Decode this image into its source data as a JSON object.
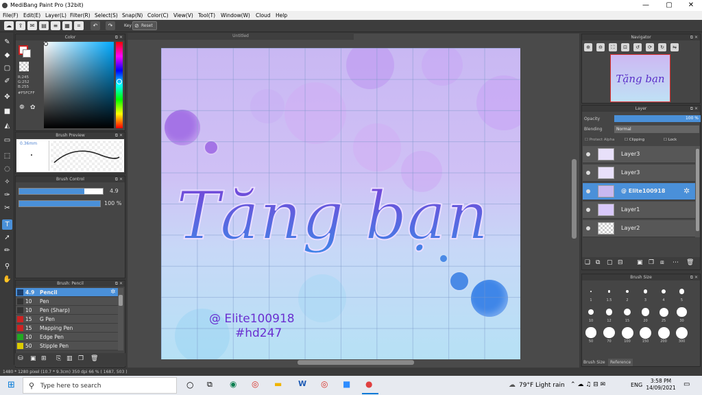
{
  "app": {
    "title": "MediBang Paint Pro (32bit)"
  },
  "window_controls": {
    "minimize": "—",
    "maximize": "▢",
    "close": "✕"
  },
  "menu": [
    "File(F)",
    "Edit(E)",
    "Layer(L)",
    "Filter(R)",
    "Select(S)",
    "Snap(N)",
    "Color(C)",
    "View(V)",
    "Tool(T)",
    "Window(W)",
    "Cloud",
    "Help"
  ],
  "toolbar": {
    "key_label": "Key",
    "reset_label": "Reset"
  },
  "color_panel": {
    "title": "Color",
    "r": "R:245",
    "g": "G:252",
    "b": "B:255",
    "hex": "#F5FCFF",
    "accent": "#cc2222"
  },
  "brush_preview": {
    "title": "Brush Preview",
    "size": "0.36mm"
  },
  "brush_control": {
    "title": "Brush Control",
    "size_value": "4.9",
    "size_fill": 0.78,
    "opacity_value": "100 %",
    "opacity_fill": 1.0
  },
  "brush_list": {
    "title": "Brush: Pencil",
    "items": [
      {
        "size": "4.9",
        "name": "Pencil",
        "color": "#2266aa",
        "selected": true
      },
      {
        "size": "10",
        "name": "Pen",
        "color": "#333333",
        "selected": false
      },
      {
        "size": "10",
        "name": "Pen (Sharp)",
        "color": "#333333",
        "selected": false
      },
      {
        "size": "15",
        "name": "G Pen",
        "color": "#cc2222",
        "selected": false
      },
      {
        "size": "15",
        "name": "Mapping Pen",
        "color": "#cc2222",
        "selected": false
      },
      {
        "size": "10",
        "name": "Edge Pen",
        "color": "#22aa22",
        "selected": false
      },
      {
        "size": "50",
        "name": "Stipple Pen",
        "color": "#ddcc00",
        "selected": false
      }
    ]
  },
  "document": {
    "tab": "Untitled",
    "artwork_title": "Tăng bạn",
    "credit_line1": "@ Elite100918",
    "credit_line2": "#hd247"
  },
  "navigator": {
    "title": "Navigator",
    "thumb_text": "Tặng bạn"
  },
  "layer_panel": {
    "title": "Layer",
    "opacity_label": "Opacity",
    "opacity_value": "100 %",
    "blending_label": "Blending",
    "blending_value": "Normal",
    "protect_alpha": "Protect Alpha",
    "clipping": "Clipping",
    "lock": "Lock",
    "layers": [
      {
        "name": "Layer3",
        "selected": false
      },
      {
        "name": "Layer3",
        "selected": false
      },
      {
        "name": "@ Elite100918",
        "selected": true
      },
      {
        "name": "Layer1",
        "selected": false
      },
      {
        "name": "Layer2",
        "selected": false
      }
    ]
  },
  "brush_size": {
    "title": "Brush Size",
    "sizes": [
      "1",
      "1.5",
      "2",
      "3",
      "4",
      "5",
      "10",
      "12",
      "15",
      "20",
      "25",
      "30",
      "50",
      "70",
      "100",
      "150",
      "200",
      "300"
    ],
    "tabs": [
      "Brush Size",
      "Reference"
    ]
  },
  "status": {
    "text": "1480 * 1280 pixel  (10.7 * 9.3cm)  350 dpi  66 %  ( 1687, 503 )"
  },
  "taskbar": {
    "search_placeholder": "Type here to search",
    "weather": "79°F  Light rain",
    "lang": "ENG",
    "time": "3:58 PM",
    "date": "14/09/2021"
  },
  "colors": {
    "selection": "#4a90d9",
    "panel_bg": "#454545"
  }
}
